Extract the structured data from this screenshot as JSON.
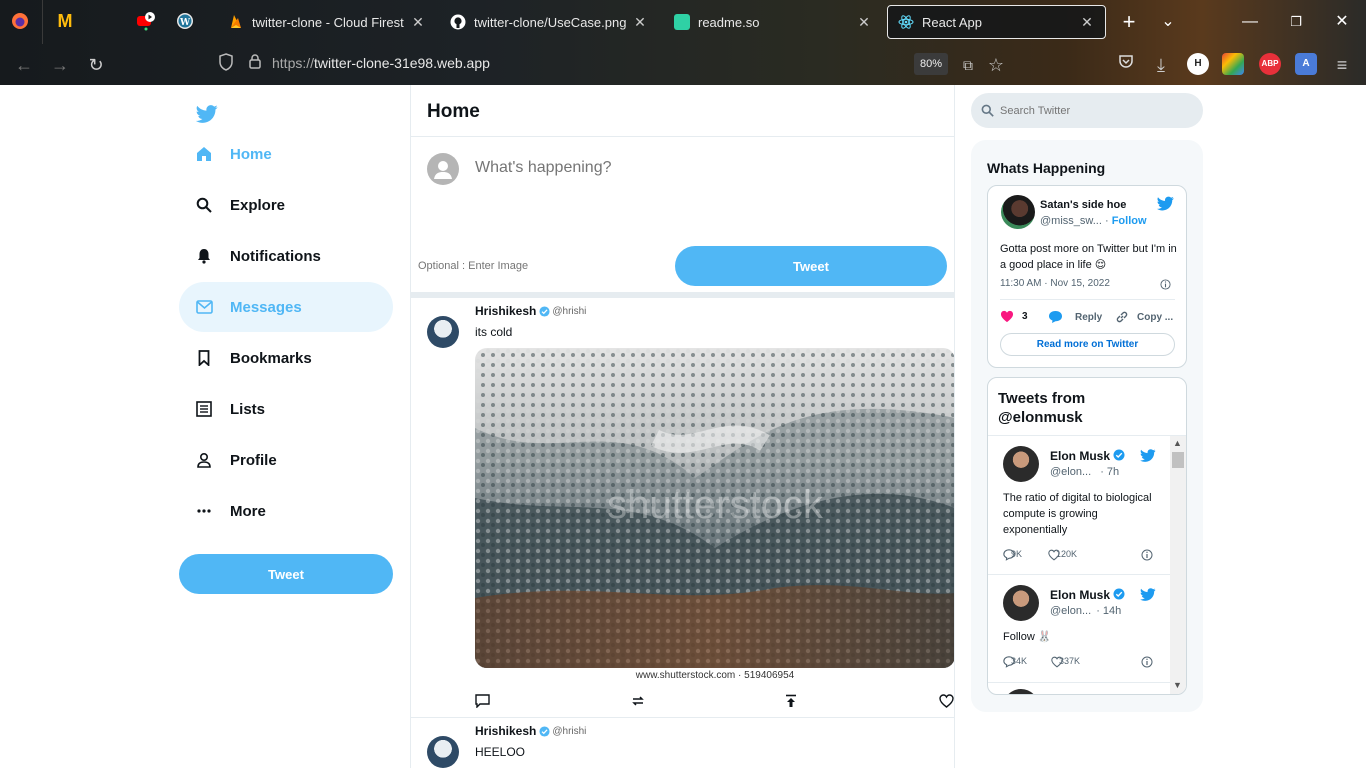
{
  "browser": {
    "tabs": [
      {
        "title": "twitter-clone - Cloud Firestore"
      },
      {
        "title": "twitter-clone/UseCase.png at m"
      },
      {
        "title": "readme.so"
      },
      {
        "title": "React App"
      }
    ],
    "url_proto": "https://",
    "url_host": "twitter-clone-31e98.web.app",
    "zoom": "80%",
    "ext_h": "H",
    "ext_abp": "ABP",
    "ext_translate": "A"
  },
  "sidebar": {
    "items": [
      {
        "label": "Home",
        "icon": "home-icon"
      },
      {
        "label": "Explore",
        "icon": "search-icon"
      },
      {
        "label": "Notifications",
        "icon": "bell-icon"
      },
      {
        "label": "Messages",
        "icon": "mail-icon"
      },
      {
        "label": "Bookmarks",
        "icon": "bookmark-icon"
      },
      {
        "label": "Lists",
        "icon": "list-icon"
      },
      {
        "label": "Profile",
        "icon": "person-icon"
      },
      {
        "label": "More",
        "icon": "more-icon"
      }
    ],
    "tweet_button": "Tweet"
  },
  "feed": {
    "title": "Home",
    "composer": {
      "placeholder": "What's happening?",
      "image_placeholder": "Optional : Enter Image",
      "tweet_button": "Tweet"
    },
    "posts": [
      {
        "name": "Hrishikesh",
        "handle": "@hrishi",
        "text": "its cold",
        "image_caption": "www.shutterstock.com · 519406954",
        "watermark": "shutterstock"
      },
      {
        "name": "Hrishikesh",
        "handle": "@hrishi",
        "text": "HEELOO"
      }
    ]
  },
  "right": {
    "search_placeholder": "Search Twitter",
    "widget_title": "Whats Happening",
    "embed": {
      "name": "Satan's side hoe",
      "handle": "@miss_sw...",
      "separator": "·",
      "follow": "Follow",
      "text": "Gotta post more on Twitter but I'm in a good place in life 😌",
      "time": "11:30 AM · Nov 15, 2022",
      "likes": "3",
      "reply": "Reply",
      "copy": "Copy ...",
      "read_more": "Read more on Twitter"
    },
    "timeline": {
      "title": "Tweets from @elonmusk",
      "tweets": [
        {
          "name": "Elon Musk",
          "handle": "@elon...",
          "age": "· 7h",
          "text": "The ratio of digital to biological compute is growing exponentially",
          "replies": "9K",
          "likes": "120K"
        },
        {
          "name": "Elon Musk",
          "handle": "@elon...",
          "age": "· 14h",
          "text": "Follow 🐰",
          "replies": "34K",
          "likes": "337K"
        }
      ]
    }
  },
  "colors": {
    "accent": "#50b7f5",
    "twitter_blue": "#1d9bf0"
  }
}
